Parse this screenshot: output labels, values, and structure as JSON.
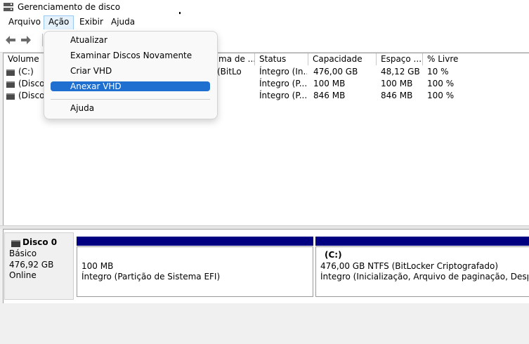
{
  "window": {
    "title": "Gerenciamento de disco"
  },
  "menubar": [
    "Arquivo",
    "Ação",
    "Exibir",
    "Ajuda"
  ],
  "dropdown": {
    "items": [
      "Atualizar",
      "Examinar Discos Novamente",
      "Criar VHD",
      "Anexar VHD",
      "Ajuda"
    ],
    "highlighted": "Anexar VHD"
  },
  "columns": [
    "Volume",
    "ma de ...",
    "Status",
    "Capacidade",
    "Espaço ...",
    "% Livre"
  ],
  "volumes": [
    {
      "name": "(C:)",
      "fs": "(BitLo",
      "status": "Íntegro (In...",
      "capacity": "476,00 GB",
      "free": "48,12 GB",
      "pct": "10 %"
    },
    {
      "name": "(Disco 0",
      "fs": "",
      "status": "Íntegro (P...",
      "capacity": "100 MB",
      "free": "100 MB",
      "pct": "100 %"
    },
    {
      "name": "(Disco 0",
      "fs": "",
      "status": "Íntegro (P...",
      "capacity": "846 MB",
      "free": "846 MB",
      "pct": "100 %"
    }
  ],
  "disk0": {
    "name": "Disco 0",
    "type": "Básico",
    "size": "476,92 GB",
    "state": "Online",
    "partitions": [
      {
        "title": "",
        "size": "100 MB",
        "desc": "Íntegro (Partição de Sistema EFI)"
      },
      {
        "title": "(C:)",
        "size": "476,00 GB NTFS (BitLocker Criptografado)",
        "desc": "Íntegro (Inicialização, Arquivo de paginação, Despejo de"
      }
    ]
  },
  "colors": {
    "partition_bar": "#000080",
    "highlight": "#1f6fd1"
  },
  "icons": [
    "disk-management-icon",
    "back-arrow-icon",
    "forward-arrow-icon",
    "volume-icon",
    "hard-disk-icon"
  ]
}
